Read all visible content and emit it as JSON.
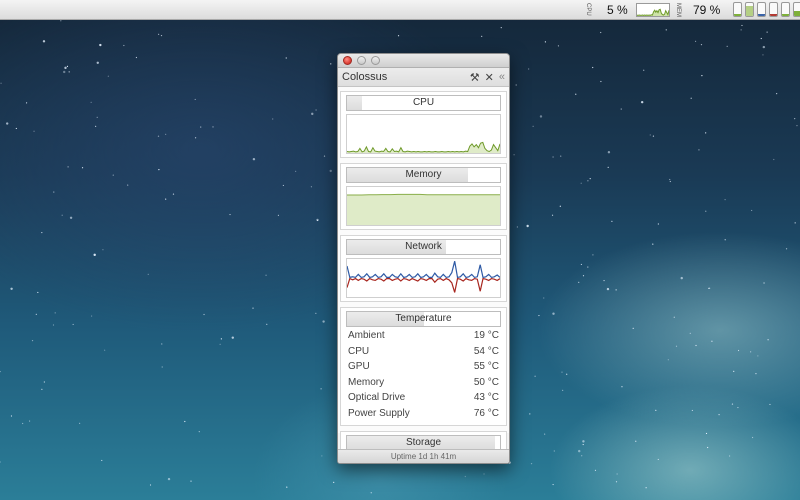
{
  "menubar": {
    "cpu_label": "CPU",
    "cpu_value": "5 %",
    "mem_label": "MEM",
    "mem_value": "79 %",
    "status_bars": [
      {
        "name": "cpu",
        "level": 0.15,
        "color": "#7fb03a"
      },
      {
        "name": "memory",
        "level": 0.79,
        "color": "#b4cf84"
      },
      {
        "name": "network-in",
        "level": 0.1,
        "color": "#3b64a8"
      },
      {
        "name": "network-out",
        "level": 0.1,
        "color": "#b33a33"
      },
      {
        "name": "temperature",
        "level": 0.15,
        "color": "#7fb03a"
      },
      {
        "name": "fan",
        "level": 0.35,
        "color": "#7fb03a"
      },
      {
        "name": "storage",
        "level": 0.45,
        "color": "#7fb03a"
      }
    ]
  },
  "window": {
    "title": "Colossus",
    "header_icons": [
      "wrench-icon",
      "close-x-icon",
      "collapse-icon"
    ],
    "header_glyphs": [
      "⚒",
      "✕",
      "«"
    ]
  },
  "panels": {
    "cpu": {
      "label": "CPU",
      "level": 0.1
    },
    "memory": {
      "label": "Memory",
      "level": 0.79
    },
    "network": {
      "label": "Network",
      "level": 0.65
    },
    "temperature": {
      "label": "Temperature",
      "level": 0.5
    },
    "storage": {
      "label": "Storage",
      "level": 0.97
    }
  },
  "temperatures": [
    {
      "name": "Ambient",
      "value": "19 °C"
    },
    {
      "name": "CPU",
      "value": "54 °C"
    },
    {
      "name": "GPU",
      "value": "55 °C"
    },
    {
      "name": "Memory",
      "value": "50 °C"
    },
    {
      "name": "Optical Drive",
      "value": "43 °C"
    },
    {
      "name": "Power Supply",
      "value": "76 °C"
    }
  ],
  "cpu_history": [
    4,
    3,
    4,
    5,
    3,
    4,
    12,
    3,
    5,
    16,
    4,
    3,
    14,
    5,
    4,
    3,
    5,
    4,
    12,
    4,
    3,
    11,
    4,
    5,
    3,
    14,
    4,
    3,
    5,
    4,
    3,
    4,
    3,
    4,
    3,
    3,
    4,
    3,
    4,
    3,
    3,
    4,
    3,
    3,
    4,
    3,
    3,
    4,
    3,
    4,
    3,
    4,
    3,
    4,
    3,
    5,
    4,
    18,
    24,
    16,
    22,
    14,
    26,
    28,
    12,
    6,
    4,
    8,
    22,
    14,
    6,
    24
  ],
  "memory_history": [
    79,
    79,
    79,
    79.5,
    79.5,
    80,
    80,
    80.5,
    80.5,
    80.5,
    80.5,
    79.5,
    79.5,
    79.5,
    79.5,
    79.5,
    79.5,
    79.5,
    79.5,
    79.5,
    79.5,
    79.5
  ],
  "network_in": [
    20,
    1,
    2,
    1,
    6,
    1,
    2,
    7,
    1,
    2,
    6,
    1,
    2,
    7,
    1,
    1,
    6,
    2,
    1,
    7,
    1,
    2,
    6,
    1,
    2,
    7,
    1,
    2,
    6,
    1,
    1,
    8,
    2,
    1,
    6,
    1,
    2,
    9,
    28,
    1,
    2,
    7,
    1,
    2,
    6,
    1,
    2,
    22,
    1,
    2,
    6,
    1,
    2,
    5,
    1
  ],
  "network_out": [
    16,
    1,
    3,
    1,
    4,
    1,
    2,
    5,
    1,
    3,
    4,
    1,
    2,
    5,
    1,
    1,
    4,
    2,
    1,
    5,
    1,
    2,
    4,
    1,
    3,
    5,
    1,
    2,
    4,
    1,
    1,
    7,
    2,
    1,
    4,
    1,
    3,
    8,
    24,
    1,
    2,
    5,
    1,
    3,
    4,
    1,
    2,
    22,
    1,
    2,
    4,
    1,
    2,
    4,
    1
  ],
  "uptime": "Uptime 1d 1h 41m"
}
